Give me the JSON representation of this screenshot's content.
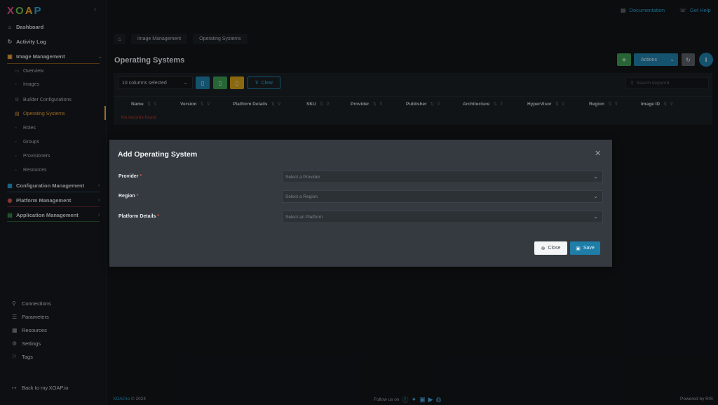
{
  "app": {
    "logo": [
      "X",
      "O",
      "A",
      "P"
    ]
  },
  "topbar": {
    "documentation": "Documentation",
    "help": "Get Help"
  },
  "sidebar": {
    "items": [
      {
        "label": "Dashboard"
      },
      {
        "label": "Activity Log"
      },
      {
        "label": "Image Management"
      },
      {
        "label": "Configuration Management"
      },
      {
        "label": "Platform Management"
      },
      {
        "label": "Application Management"
      }
    ],
    "subitems": [
      {
        "label": "Overview"
      },
      {
        "label": "Images"
      },
      {
        "label": "Builder Configurations"
      },
      {
        "label": "Operating Systems"
      },
      {
        "label": "Roles"
      },
      {
        "label": "Groups"
      },
      {
        "label": "Provisioners"
      },
      {
        "label": "Resources"
      }
    ],
    "bottom": [
      {
        "label": "Connections"
      },
      {
        "label": "Parameters"
      },
      {
        "label": "Resources"
      },
      {
        "label": "Settings"
      },
      {
        "label": "Tags"
      }
    ],
    "back": "Back to my.XOAP.io"
  },
  "breadcrumb": [
    "Image Management",
    "Operating Systems"
  ],
  "page": {
    "title": "Operating Systems",
    "actions_label": "Actions"
  },
  "table": {
    "columns_selected": "10 columns selected",
    "clear_label": "Clear",
    "search_placeholder": "Search keyword",
    "columns": [
      "Name",
      "Version",
      "Platform Details",
      "SKU",
      "Provider",
      "Publisher",
      "Architecture",
      "HyperVisor",
      "Region",
      "Image ID"
    ],
    "empty_message": "No records found"
  },
  "modal": {
    "title": "Add Operating System",
    "fields": [
      {
        "label": "Provider",
        "placeholder": "Select a Provider"
      },
      {
        "label": "Region",
        "placeholder": "Select a Region"
      },
      {
        "label": "Platform Details",
        "placeholder": "Select an Platform"
      }
    ],
    "required_mark": "*",
    "close_label": "Close",
    "save_label": "Save"
  },
  "footer": {
    "brand": "XOAP.io",
    "copyright": "© 2024",
    "follow": "Follow us on",
    "powered": "Powered by RIS"
  },
  "colors": {
    "accent": "#1f7ea8",
    "active": "#f0a33a",
    "success": "#3c9b52",
    "warning": "#d4a017",
    "danger": "#e05555"
  }
}
